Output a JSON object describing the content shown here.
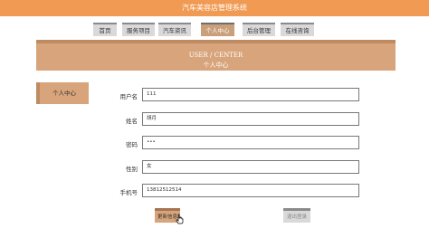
{
  "site": {
    "title": "汽车美容店管理系统"
  },
  "nav": {
    "items": [
      {
        "label": "首页",
        "active": false
      },
      {
        "label": "服务项目",
        "active": false
      },
      {
        "label": "汽车资讯",
        "active": false
      },
      {
        "label": "个人中心",
        "active": true
      },
      {
        "label": "后台管理",
        "active": false
      },
      {
        "label": "在线咨询",
        "active": false
      }
    ]
  },
  "banner": {
    "en": "USER / CENTER",
    "cn": "个人中心"
  },
  "side": {
    "tab_label": "个人中心"
  },
  "form": {
    "username": {
      "label": "用户名",
      "value": "111"
    },
    "name": {
      "label": "姓名",
      "value": "胡月"
    },
    "password": {
      "label": "密码",
      "value": "•••"
    },
    "gender": {
      "label": "性别",
      "value": "女"
    },
    "phone": {
      "label": "手机号",
      "value": "13812512514"
    }
  },
  "buttons": {
    "update": "更新信息",
    "logout": "退出登录"
  },
  "colors": {
    "accent": "#f19a53",
    "banner": "#d8a47b",
    "banner_dark": "#bf8b62"
  }
}
